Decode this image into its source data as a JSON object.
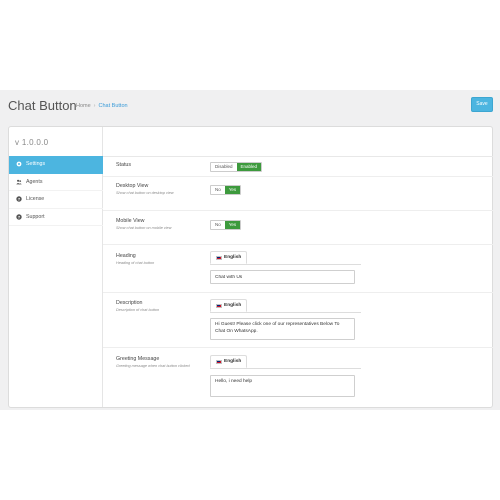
{
  "header": {
    "title": "Chat Button",
    "breadcrumb": {
      "home": "Home",
      "separator": "›",
      "current": "Chat Button"
    },
    "save_label": "Save"
  },
  "sidebar": {
    "version": "v 1.0.0.0",
    "items": [
      {
        "label": "Settings",
        "icon": "gear-icon",
        "active": true
      },
      {
        "label": "Agents",
        "icon": "users-icon",
        "active": false
      },
      {
        "label": "License",
        "icon": "question-circle-icon",
        "active": false
      },
      {
        "label": "Support",
        "icon": "question-circle-icon",
        "active": false
      }
    ]
  },
  "settings": {
    "status": {
      "label": "Status",
      "off_label": "Disabled",
      "on_label": "Enabled",
      "value": "Enabled"
    },
    "desktop_view": {
      "label": "Desktop View",
      "help": "Show chat button on desktop view",
      "off_label": "No",
      "on_label": "Yes",
      "value": "Yes"
    },
    "mobile_view": {
      "label": "Mobile View",
      "help": "Show chat button on mobile view",
      "off_label": "No",
      "on_label": "Yes",
      "value": "Yes"
    },
    "heading": {
      "label": "Heading",
      "help": "Heading of chat button",
      "language": "English",
      "value": "Chat with Us"
    },
    "description": {
      "label": "Description",
      "help": "Description of chat button",
      "language": "English",
      "value": "Hi Guest! Please click one of our representatives Below To Chat On WhatsApp."
    },
    "greeting": {
      "label": "Greeting Message",
      "help": "Greeting message when chat button clicked",
      "language": "English",
      "value": "Hello, i need help"
    }
  },
  "colors": {
    "accent": "#4cb5e0",
    "toggle_on": "#3d9a3d",
    "background": "#f0f0f1"
  }
}
